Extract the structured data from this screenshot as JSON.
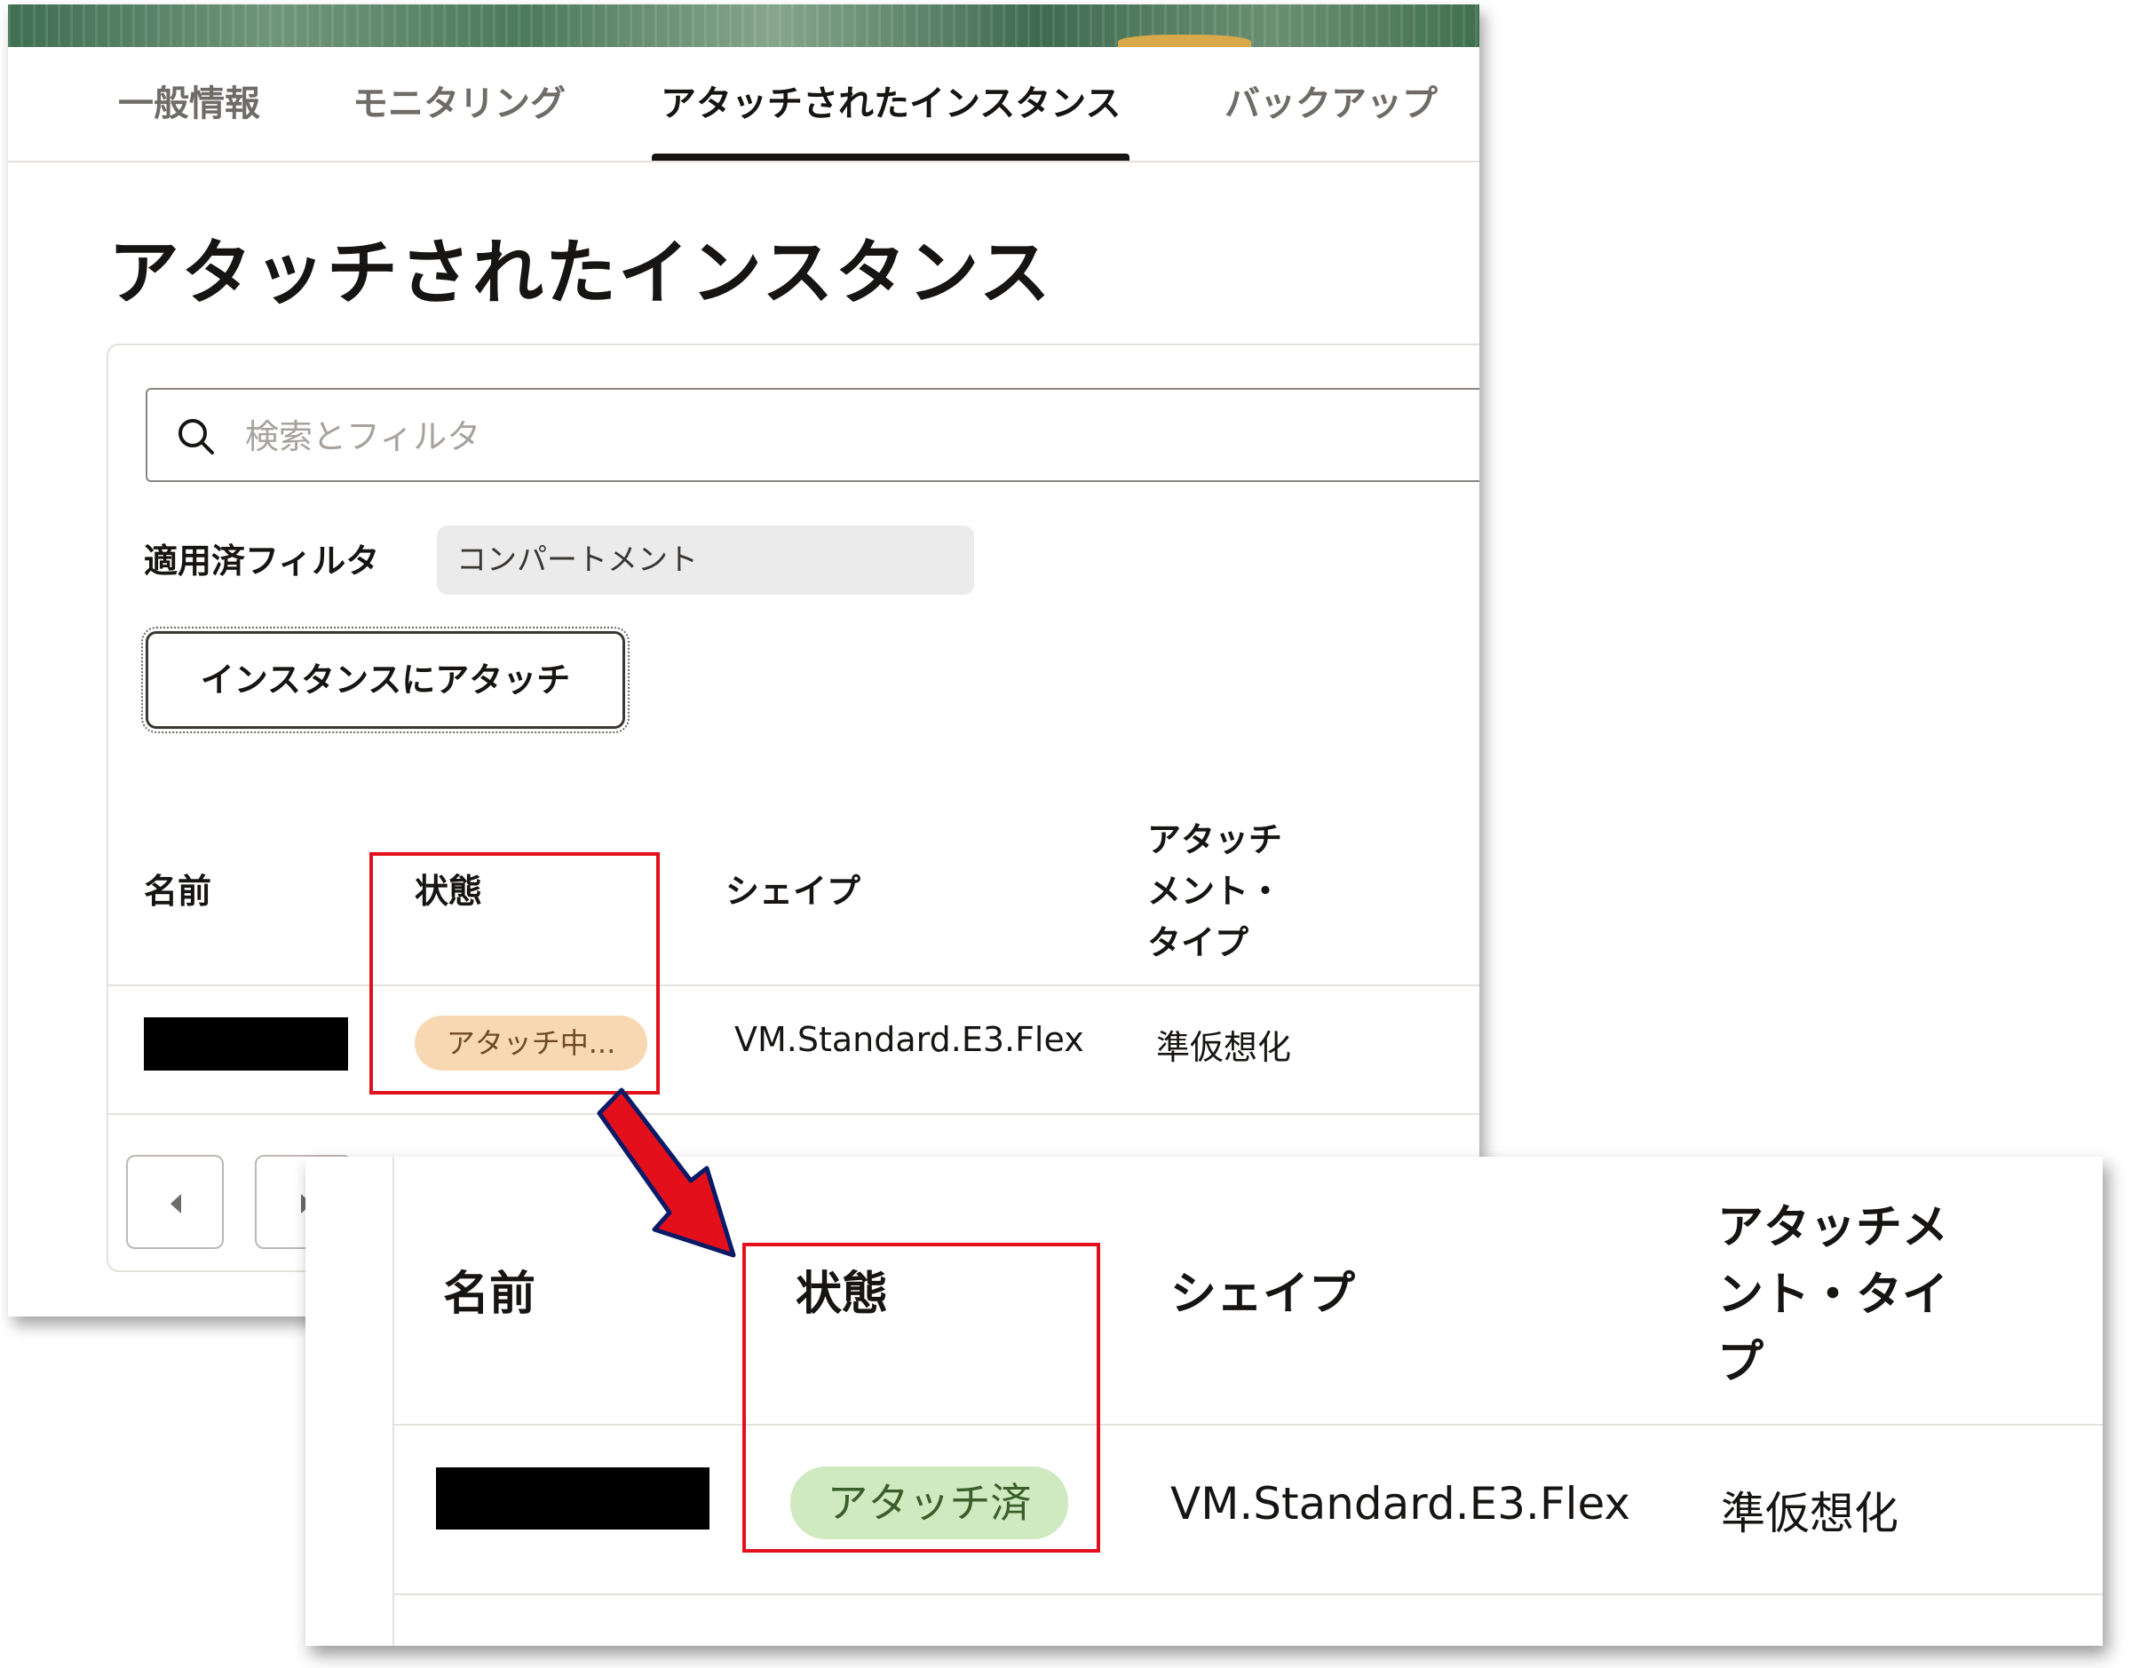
{
  "tabs": [
    "一般情報",
    "モニタリング",
    "アタッチされたインスタンス",
    "バックアップ"
  ],
  "active_tab_index": 2,
  "page_title": "アタッチされたインスタンス",
  "search": {
    "placeholder": "検索とフィルタ",
    "value": ""
  },
  "filters": {
    "label": "適用済フィルタ",
    "chip": "コンパートメント"
  },
  "attach_button": "インスタンスにアタッチ",
  "table_before": {
    "headers": {
      "name": "名前",
      "state": "状態",
      "shape": "シェイプ",
      "attachment_type": "アタッチメント・タイプ",
      "attachment_type_lines": [
        "アタッチ",
        "メント・",
        "タイプ"
      ]
    },
    "row": {
      "state": "アタッチ中...",
      "shape": "VM.Standard.E3.Flex",
      "attachment_type": "準仮想化"
    }
  },
  "table_after": {
    "headers": {
      "name": "名前",
      "state": "状態",
      "shape": "シェイプ",
      "attachment_type": "アタッチメント・タイプ",
      "attachment_type_lines": [
        "アタッチメ",
        "ント・タイ",
        "プ"
      ]
    },
    "row": {
      "state": "アタッチ済",
      "shape": "VM.Standard.E3.Flex",
      "attachment_type": "準仮想化"
    }
  },
  "colors": {
    "highlight": "#e3101c",
    "arrow": "#e3101c",
    "badge_pending": "#f8d8b2",
    "badge_done": "#cfe9c0"
  },
  "icons": [
    "search-icon",
    "chevron-left-icon",
    "chevron-right-icon",
    "down-right-arrow-icon"
  ]
}
